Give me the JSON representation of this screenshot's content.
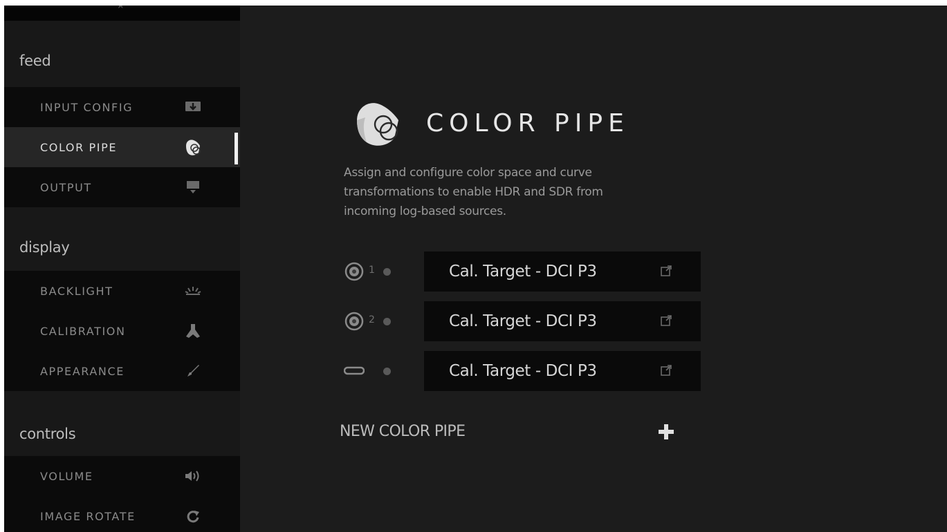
{
  "sidebar": {
    "sections": [
      {
        "label": "feed",
        "items": [
          {
            "label": "INPUT CONFIG",
            "icon": "input-config-icon",
            "active": false
          },
          {
            "label": "COLOR PIPE",
            "icon": "color-pipe-icon",
            "active": true
          },
          {
            "label": "OUTPUT",
            "icon": "output-icon",
            "active": false
          }
        ]
      },
      {
        "label": "display",
        "items": [
          {
            "label": "BACKLIGHT",
            "icon": "backlight-icon",
            "active": false
          },
          {
            "label": "CALIBRATION",
            "icon": "calibration-icon",
            "active": false
          },
          {
            "label": "APPEARANCE",
            "icon": "appearance-icon",
            "active": false
          }
        ]
      },
      {
        "label": "controls",
        "items": [
          {
            "label": "VOLUME",
            "icon": "volume-icon",
            "active": false
          },
          {
            "label": "IMAGE ROTATE",
            "icon": "rotate-icon",
            "active": false
          }
        ]
      }
    ]
  },
  "main": {
    "title": "COLOR PIPE",
    "description_lines": [
      "Assign and configure color space and curve",
      "transformations to enable HDR and SDR from",
      "incoming log-based sources."
    ],
    "pipes": [
      {
        "input": "sdi-icon",
        "number": "1",
        "target": "Cal. Target - DCI P3"
      },
      {
        "input": "sdi-icon",
        "number": "2",
        "target": "Cal. Target - DCI P3"
      },
      {
        "input": "hdmi-icon",
        "number": "",
        "target": "Cal. Target - DCI P3"
      }
    ],
    "new_pipe_label": "NEW COLOR PIPE",
    "add_icon": "plus-icon"
  },
  "colors": {
    "background": "#1c1c1c",
    "sidebar_item": "#0b0b0b",
    "sidebar_active": "#262626",
    "active_indicator": "#f2f2f2",
    "target_box": "#0a0a0a"
  }
}
